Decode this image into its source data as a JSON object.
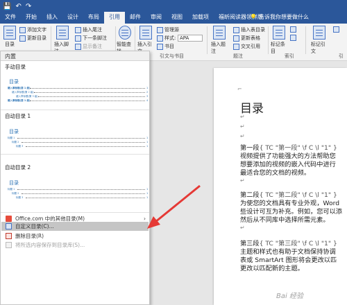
{
  "qat": {
    "save": "💾",
    "undo": "↶",
    "redo": "↷"
  },
  "tabs": [
    "文件",
    "开始",
    "插入",
    "设计",
    "布局",
    "引用",
    "邮件",
    "审阅",
    "视图",
    "加载项",
    "福昕阅读器领鲜版"
  ],
  "active_tab": "引用",
  "tell_me": "告诉我你想要做什么",
  "ribbon": {
    "toc": "目录",
    "add_text": "添加文字",
    "update_toc": "更新目录",
    "insert_footnote": "插入脚注",
    "insert_endnote": "插入尾注",
    "next_footnote": "下一条脚注",
    "show_notes": "显示备注",
    "smart_lookup": "智能查找",
    "insert_citation": "插入引文",
    "manage_sources": "管理源",
    "style_label": "样式:",
    "style_value": "APA",
    "bibliography": "书目",
    "insert_caption": "插入题注",
    "insert_tof": "插入表目录",
    "update_table": "更新表格",
    "cross_ref": "交叉引用",
    "mark_entry": "标记条目",
    "mark_citation": "标记引文",
    "group_citations": "引文与书目",
    "group_captions": "题注",
    "group_index": "索引",
    "group_toa": "引"
  },
  "gallery": {
    "header": "内置",
    "manual_title": "手动目录",
    "manual_preview_title": "目录",
    "manual_lines": [
      "键入章标题(第 1 级)",
      "键入章标题(第 2 级)",
      "键入章标题(第 3 级)",
      "键入章标题(第 1 级)"
    ],
    "auto1_title": "自动目录 1",
    "auto1_preview_title": "目录",
    "auto1_lines": [
      "标题 1",
      "标题 2",
      "标题 3"
    ],
    "auto2_title": "自动目录 2",
    "auto2_preview_title": "目录",
    "auto2_lines": [
      "标题 1",
      "标题 2",
      "标题 3"
    ],
    "nums": [
      "1",
      "2",
      "3",
      "4"
    ],
    "office_item": "Office.com 中的其他目录(M)",
    "custom_item": "自定义目录(C)...",
    "delete_item": "删除目录(R)",
    "save_item": "将所选内容保存到目录库(S)..."
  },
  "document": {
    "title": "目录",
    "lines": [
      {
        "pre": "第一段",
        "field": "{ TC \"第一段\" \\f C \\l \"1\" }"
      },
      {
        "pre": "视频提供了功能强大的方法帮助您",
        "field": ""
      },
      {
        "pre": "想要添加的视频的嵌入代码中进行",
        "field": ""
      },
      {
        "pre": "最适合您的文档的视频。",
        "field": ""
      },
      {
        "pre": "第二段",
        "field": "{ TC \"第二段\" \\f C \\l \"1\" }"
      },
      {
        "pre": "为使您的文档具有专业外观，Word",
        "field": ""
      },
      {
        "pre": "些设计可互为补充。例如，您可以添",
        "field": ""
      },
      {
        "pre": "然后从不同库中选择所需元素。",
        "field": ""
      },
      {
        "pre": "第三段",
        "field": "{ TC \"第三段\" \\f C \\l \"1\" }"
      },
      {
        "pre": "主题和样式也有助于文档保持协调",
        "field": ""
      },
      {
        "pre": "表或 SmartArt 图形将会更改以匹",
        "field": ""
      },
      {
        "pre": "更改以匹配新的主题。",
        "field": ""
      }
    ]
  },
  "watermark": "Bai 经验",
  "colors": {
    "brand": "#2b579a",
    "arrow": "#e53935",
    "highlight": "#c5c5c5"
  }
}
